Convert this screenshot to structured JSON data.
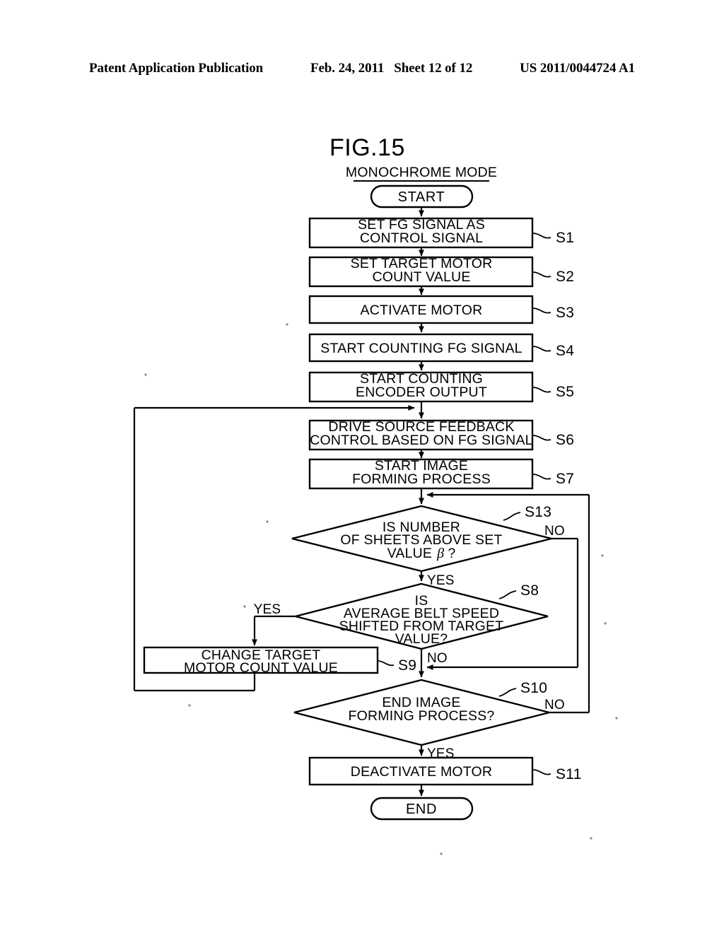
{
  "header": {
    "left": "Patent Application Publication",
    "date": "Feb. 24, 2011",
    "sheet": "Sheet 12 of 12",
    "pub_number": "US 2011/0044724 A1"
  },
  "figure": {
    "label": "FIG.15",
    "subtitle": "MONOCHROME MODE"
  },
  "colors": {
    "ink": "#000000",
    "paper": "#ffffff"
  },
  "flow": {
    "start": {
      "label": "START"
    },
    "end": {
      "label": "END"
    },
    "steps": [
      {
        "ref": "S1",
        "line1": "SET FG SIGNAL AS",
        "line2": "CONTROL SIGNAL"
      },
      {
        "ref": "S2",
        "line1": "SET TARGET MOTOR",
        "line2": "COUNT VALUE"
      },
      {
        "ref": "S3",
        "line1": "ACTIVATE MOTOR",
        "line2": ""
      },
      {
        "ref": "S4",
        "line1": "START COUNTING FG SIGNAL",
        "line2": ""
      },
      {
        "ref": "S5",
        "line1": "START COUNTING",
        "line2": "ENCODER OUTPUT"
      },
      {
        "ref": "S6",
        "line1": "DRIVE SOURCE FEEDBACK",
        "line2": "CONTROL BASED ON FG SIGNAL"
      },
      {
        "ref": "S7",
        "line1": "START IMAGE",
        "line2": "FORMING PROCESS"
      },
      {
        "ref": "S9",
        "line1": "CHANGE TARGET",
        "line2": "MOTOR COUNT VALUE"
      },
      {
        "ref": "S11",
        "line1": "DEACTIVATE MOTOR",
        "line2": ""
      }
    ],
    "decisions": [
      {
        "ref": "S13",
        "line1": "IS NUMBER",
        "line2": "OF SHEETS ABOVE SET",
        "line3_pre": "VALUE",
        "line3_sym": "β",
        "line3_post": "?",
        "yes": "YES",
        "no": "NO"
      },
      {
        "ref": "S8",
        "line1": "IS",
        "line2": "AVERAGE BELT SPEED",
        "line3": "SHIFTED FROM TARGET",
        "line4": "VALUE?",
        "yes": "YES",
        "no": "NO"
      },
      {
        "ref": "S10",
        "line1": "END IMAGE",
        "line2": "FORMING PROCESS?",
        "yes": "YES",
        "no": "NO"
      }
    ]
  }
}
